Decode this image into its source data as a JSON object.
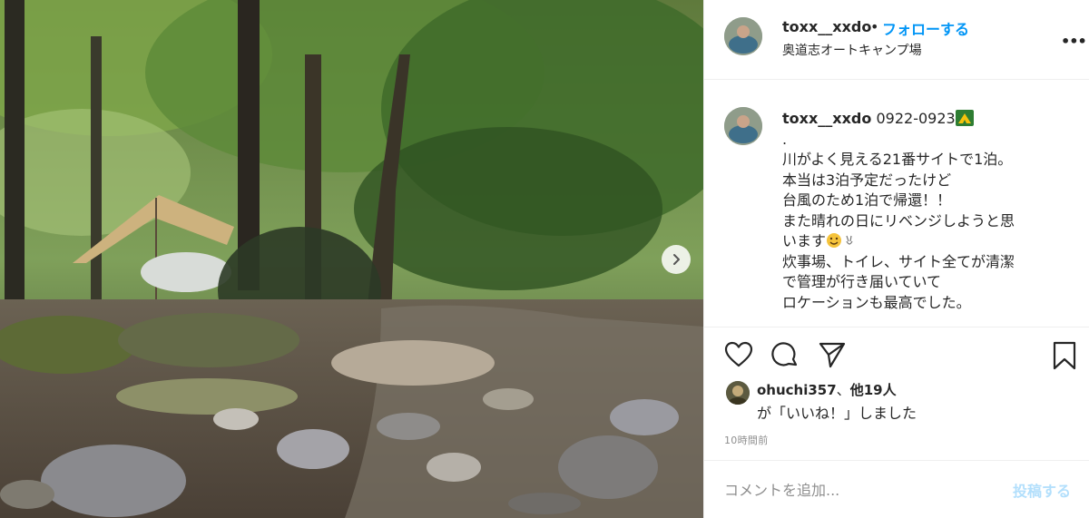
{
  "post": {
    "username": "toxx__xxdo",
    "dot": "•",
    "follow_label": "フォローする",
    "location": "奥道志オートキャンプ場",
    "more_icon": "more-horizontal-icon"
  },
  "caption": {
    "username": "toxx__xxdo",
    "first_line": "0922-0923",
    "lines": [
      ".",
      "川がよく見える21番サイトで1泊。",
      "本当は3泊予定だったけど",
      "台風のため1泊で帰還！！",
      "また晴れの日にリベンジしようと思",
      "います"
    ],
    "after_lines": [
      "炊事場、トイレ、サイト全てが清潔",
      "で管理が行き届いていて",
      "ロケーションも最高でした。"
    ]
  },
  "likes": {
    "user": "ohuchi357",
    "sep": "、",
    "others": "他19人",
    "suffix": "が「いいね！」しました"
  },
  "time_ago": "10時間前",
  "comment": {
    "placeholder": "コメントを追加...",
    "post_label": "投稿する"
  },
  "colors": {
    "follow": "#0095f6",
    "post_disabled": "#b2dffc",
    "muted": "#8e8e8e"
  }
}
